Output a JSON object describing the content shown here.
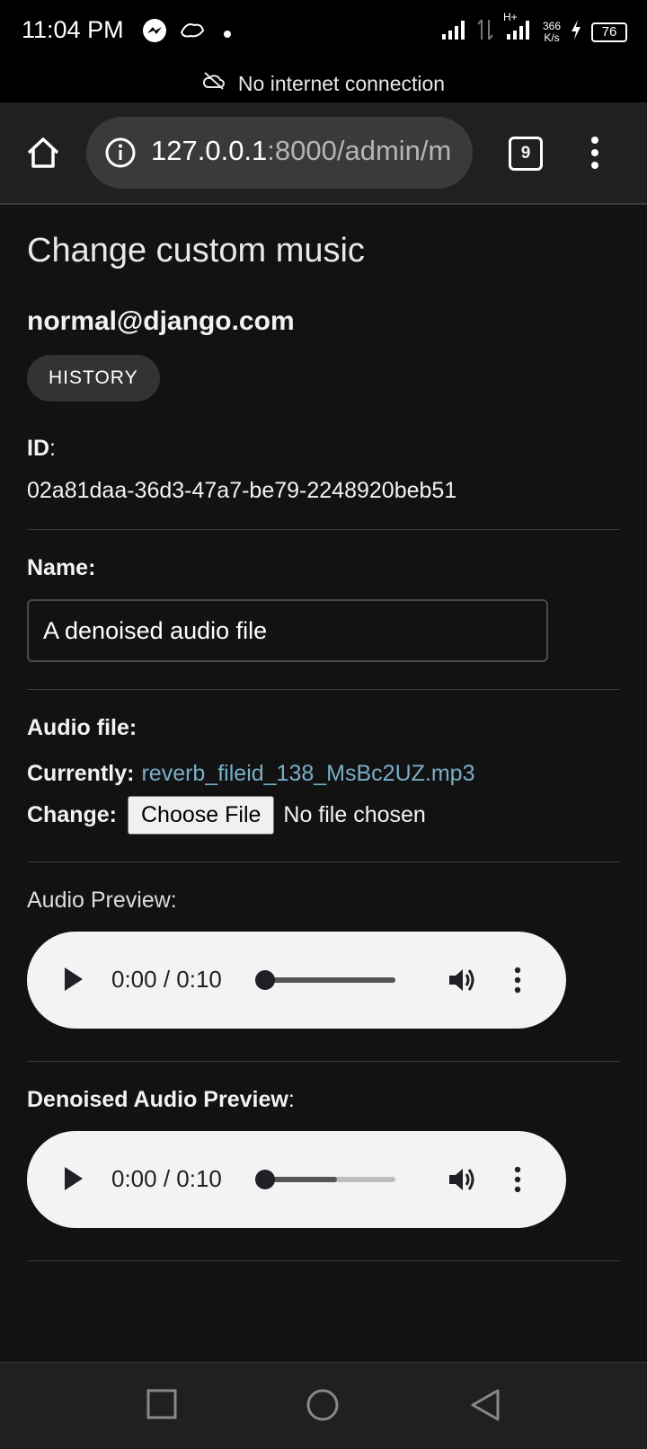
{
  "status_bar": {
    "time": "11:04 PM",
    "network_type": "H+",
    "speed_value": "366",
    "speed_unit": "K/s",
    "battery": "76",
    "icons": [
      "messenger-icon",
      "car-icon",
      "dot-icon",
      "signal-icon",
      "data-icon",
      "signal-icon",
      "charging-icon",
      "battery-icon"
    ]
  },
  "offline_banner": {
    "text": "No internet connection",
    "icon": "cloud-off-icon"
  },
  "browser": {
    "url_host": "127.0.0.1",
    "url_rest": ":8000/admin/m",
    "tab_count": "9",
    "icons": [
      "home-icon",
      "info-icon",
      "tabs-icon",
      "menu-icon"
    ]
  },
  "page": {
    "title": "Change custom music",
    "object_title": "normal@django.com",
    "history_button": "HISTORY",
    "id_label": "ID",
    "id_colon": ":",
    "id_value": "02a81daa-36d3-47a7-be79-2248920beb51",
    "name_label": "Name:",
    "name_value": "A denoised audio file",
    "audio_label": "Audio file:",
    "currently_label": "Currently:",
    "current_file": "reverb_fileid_138_MsBc2UZ.mp3",
    "change_label": "Change:",
    "choose_file_button": "Choose File",
    "no_file_text": "No file chosen",
    "preview_label": "Audio Preview:",
    "denoised_label": "Denoised Audio Preview",
    "denoised_colon": ":"
  },
  "players": [
    {
      "time": "0:00 / 0:10",
      "buffered": 1.0
    },
    {
      "time": "0:00 / 0:10",
      "buffered": 0.55
    }
  ],
  "colors": {
    "background": "#121212",
    "link": "#79aec8",
    "toolbar": "#202020",
    "player_bg": "#f1f3f4"
  }
}
